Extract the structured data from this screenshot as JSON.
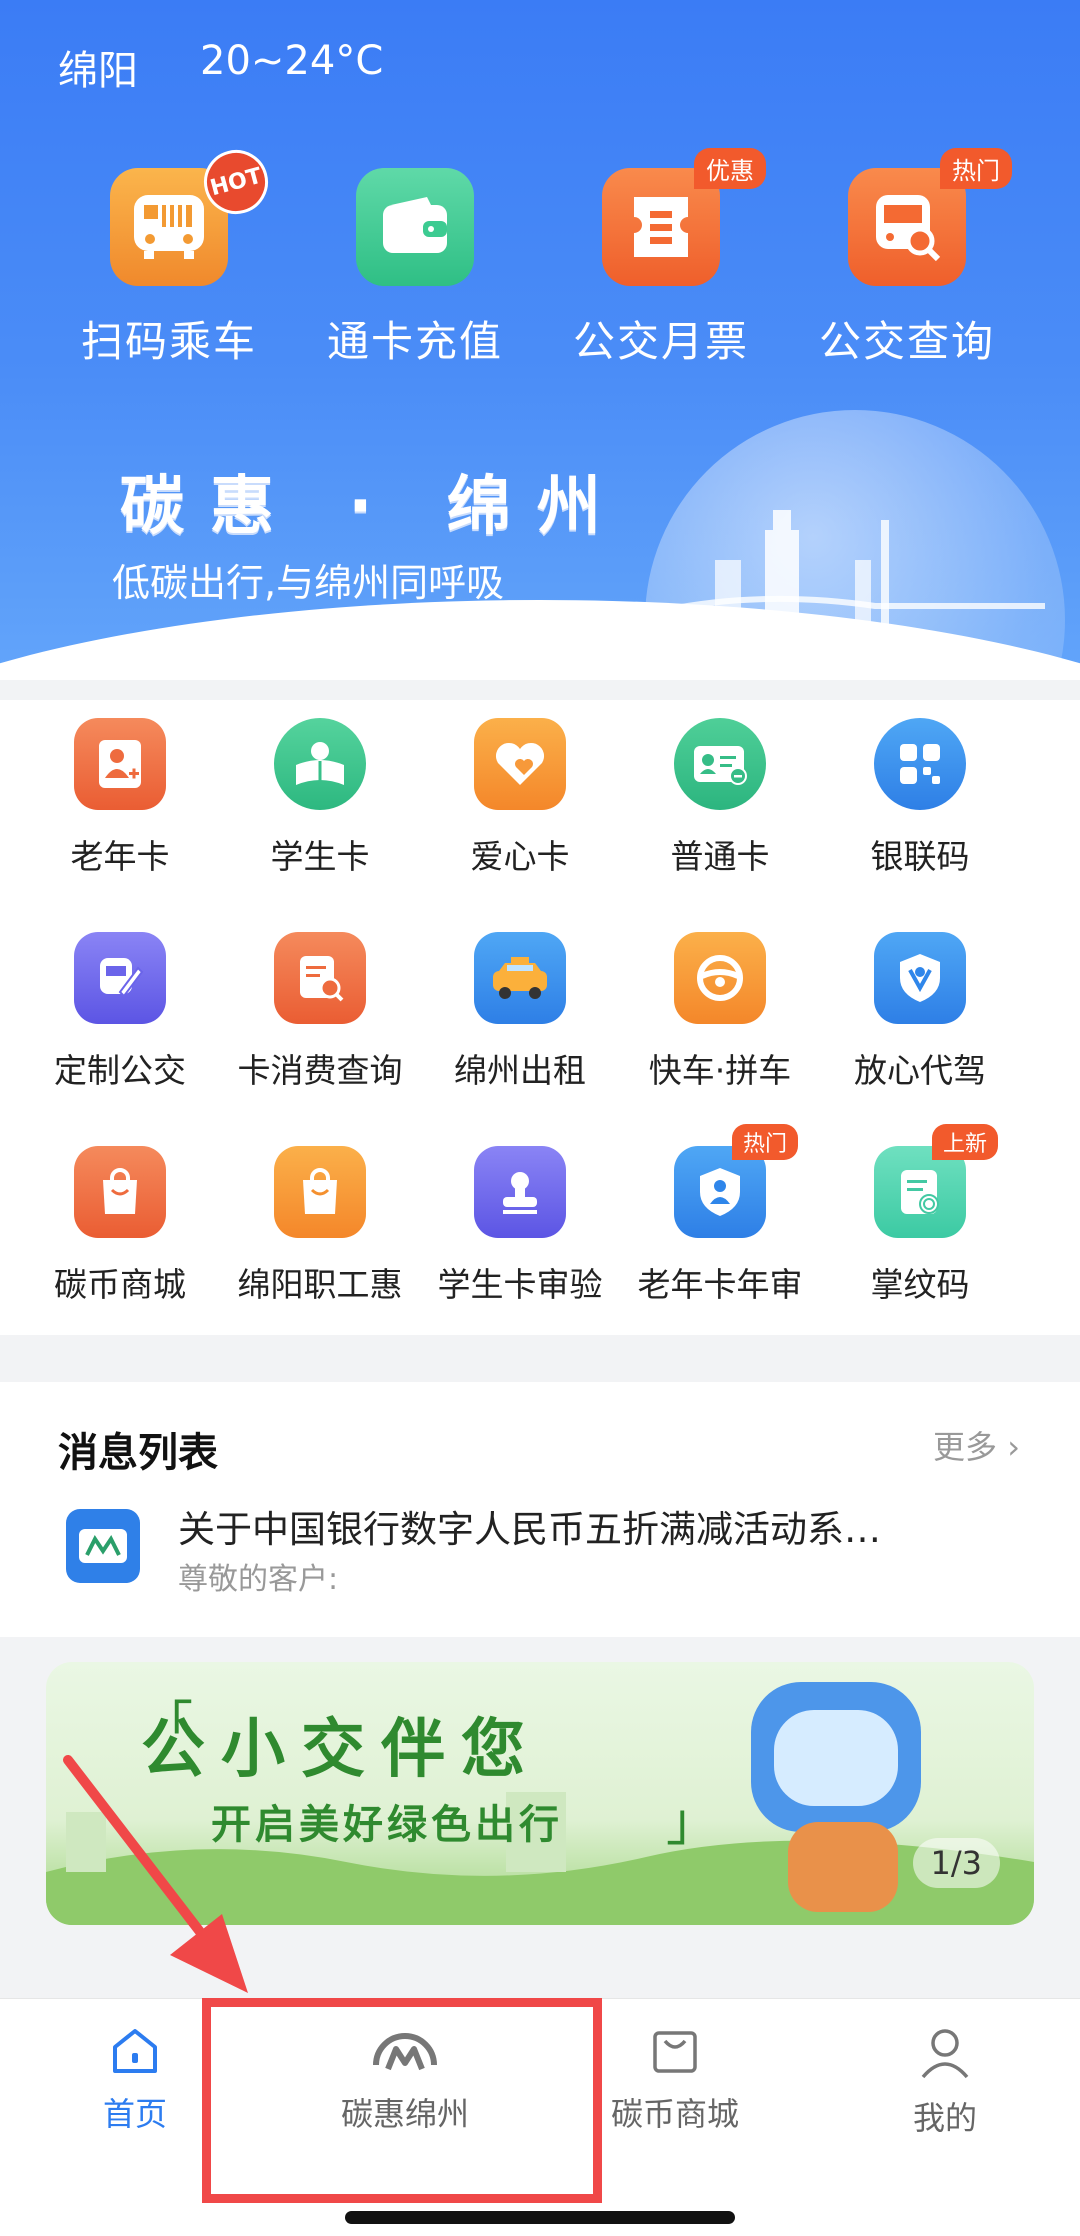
{
  "weather": {
    "city": "绵阳",
    "temp": "20~24°C"
  },
  "quick_actions": [
    {
      "label": "扫码乘车",
      "icon": "qr-bus-icon",
      "badge": "HOT"
    },
    {
      "label": "通卡充值",
      "icon": "wallet-icon",
      "badge": ""
    },
    {
      "label": "公交月票",
      "icon": "ticket-icon",
      "badge": "优惠"
    },
    {
      "label": "公交查询",
      "icon": "bus-search-icon",
      "badge": "热门"
    }
  ],
  "slogan": {
    "title": "碳惠 · 绵州",
    "subtitle": "低碳出行,与绵州同呼吸"
  },
  "services": [
    {
      "label": "老年卡",
      "icon": "elderly-card-icon",
      "badge": ""
    },
    {
      "label": "学生卡",
      "icon": "student-card-icon",
      "badge": ""
    },
    {
      "label": "爱心卡",
      "icon": "heart-card-icon",
      "badge": ""
    },
    {
      "label": "普通卡",
      "icon": "regular-card-icon",
      "badge": ""
    },
    {
      "label": "银联码",
      "icon": "unionpay-code-icon",
      "badge": ""
    },
    {
      "label": "定制公交",
      "icon": "custom-bus-icon",
      "badge": ""
    },
    {
      "label": "卡消费查询",
      "icon": "card-record-search-icon",
      "badge": ""
    },
    {
      "label": "绵州出租",
      "icon": "taxi-icon",
      "badge": ""
    },
    {
      "label": "快车·拼车",
      "icon": "steering-wheel-icon",
      "badge": ""
    },
    {
      "label": "放心代驾",
      "icon": "shield-driver-icon",
      "badge": ""
    },
    {
      "label": "碳币商城",
      "icon": "shopping-bag-icon",
      "badge": ""
    },
    {
      "label": "绵阳职工惠",
      "icon": "worker-bag-icon",
      "badge": ""
    },
    {
      "label": "学生卡审验",
      "icon": "stamp-icon",
      "badge": ""
    },
    {
      "label": "老年卡年审",
      "icon": "elderly-review-icon",
      "badge": "热门"
    },
    {
      "label": "掌纹码",
      "icon": "palmprint-icon",
      "badge": "上新"
    }
  ],
  "messages": {
    "title": "消息列表",
    "more": "更多",
    "items": [
      {
        "headline": "关于中国银行数字人民币五折满减活动系…",
        "summary": "尊敬的客户:"
      }
    ]
  },
  "banner": {
    "title": "公小交伴您",
    "subtitle": "开启美好绿色出行",
    "pager": "1/3"
  },
  "tabbar": [
    {
      "label": "首页",
      "icon": "home-icon",
      "active": true
    },
    {
      "label": "碳惠绵州",
      "icon": "carbon-logo-icon",
      "active": false
    },
    {
      "label": "碳币商城",
      "icon": "shopping-bag-icon",
      "active": false
    },
    {
      "label": "我的",
      "icon": "person-icon",
      "active": false
    }
  ],
  "colors": {
    "primary": "#3b7cf5",
    "active_tab": "#2c7cf0",
    "badge": "#f25a2c",
    "annotation": "#f04848"
  }
}
